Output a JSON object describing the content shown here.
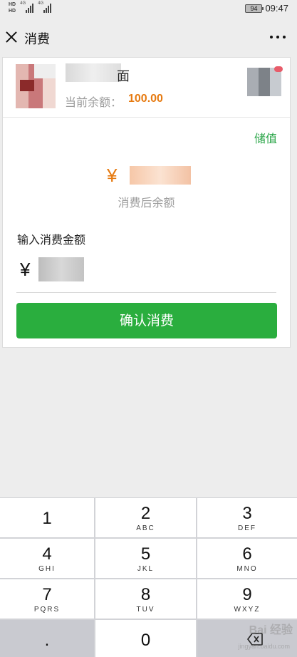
{
  "status": {
    "hd_top": "HD",
    "hd_bottom": "HD",
    "net1": "4G",
    "net2": "4G",
    "battery": "94",
    "time": "09:47"
  },
  "header": {
    "title": "消费",
    "close_icon": "close-icon",
    "more_icon": "more-icon"
  },
  "member": {
    "name_suffix": "面",
    "balance_label": "当前余额：",
    "balance_value": "100.00"
  },
  "consume": {
    "recharge_link": "储值",
    "currency": "¥",
    "after_label": "消费后余额",
    "input_label": "输入消费金额",
    "input_currency": "¥",
    "confirm_button": "确认消费"
  },
  "keypad": {
    "keys": [
      {
        "digit": "1",
        "letters": ""
      },
      {
        "digit": "2",
        "letters": "ABC"
      },
      {
        "digit": "3",
        "letters": "DEF"
      },
      {
        "digit": "4",
        "letters": "GHI"
      },
      {
        "digit": "5",
        "letters": "JKL"
      },
      {
        "digit": "6",
        "letters": "MNO"
      },
      {
        "digit": "7",
        "letters": "PQRS"
      },
      {
        "digit": "8",
        "letters": "TUV"
      },
      {
        "digit": "9",
        "letters": "WXYZ"
      },
      {
        "digit": ".",
        "letters": ""
      },
      {
        "digit": "0",
        "letters": ""
      }
    ],
    "backspace_icon": "backspace-icon"
  },
  "watermark": {
    "text": "Bai 经验",
    "sub": "jingyan.baidu.com"
  },
  "colors": {
    "accent_green": "#2aae3e",
    "link_green": "#2aa548",
    "amount_orange": "#e67a10",
    "background": "#ededed"
  }
}
